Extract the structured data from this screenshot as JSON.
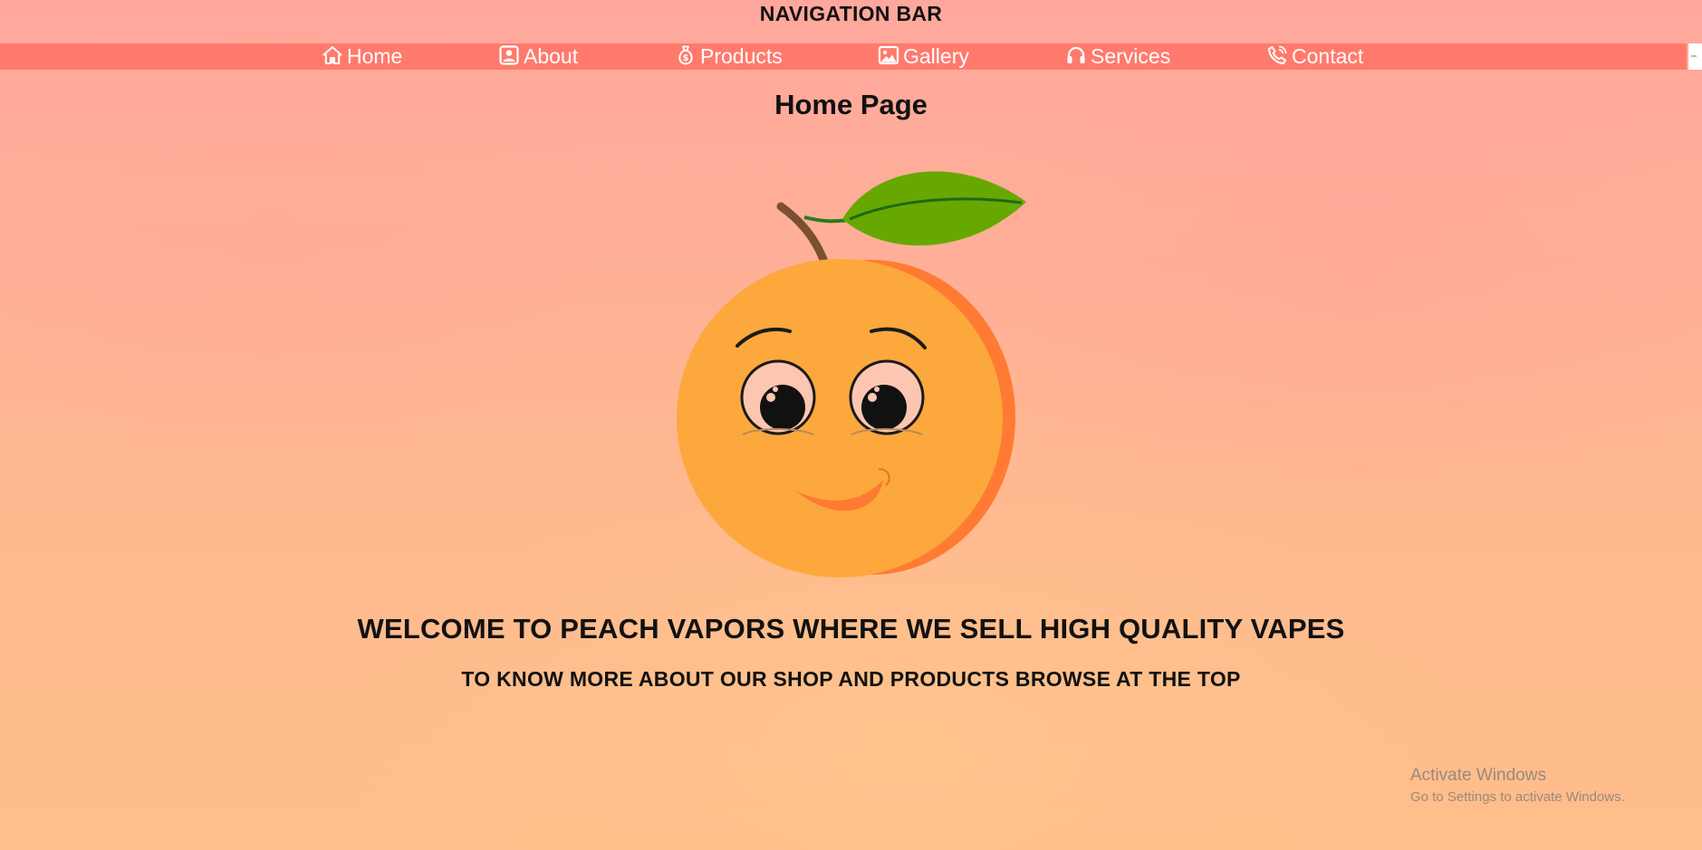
{
  "header": {
    "title": "NAVIGATION BAR"
  },
  "nav": {
    "background": "#ff7a6c",
    "items": [
      {
        "label": "Home",
        "icon": "home-icon"
      },
      {
        "label": "About",
        "icon": "user-card-icon"
      },
      {
        "label": "Products",
        "icon": "money-bag-icon"
      },
      {
        "label": "Gallery",
        "icon": "image-icon"
      },
      {
        "label": "Services",
        "icon": "headphones-icon"
      },
      {
        "label": "Contact",
        "icon": "phone-icon"
      }
    ]
  },
  "main": {
    "page_title": "Home Page",
    "hero_image": "peach-mascot",
    "welcome": "WELCOME TO PEACH VAPORS WHERE WE SELL HIGH QUALITY VAPES",
    "subtext": "TO KNOW MORE ABOUT OUR SHOP AND PRODUCTS BROWSE AT THE TOP"
  },
  "watermark": {
    "line1": "Activate Windows",
    "line2": "Go to Settings to activate Windows."
  }
}
